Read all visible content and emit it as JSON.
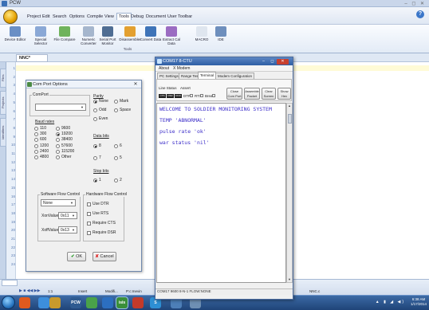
{
  "app": {
    "title": "PCW",
    "window_buttons": "– ◻ ✕",
    "menu": [
      "Project",
      "Edit",
      "Search",
      "Options",
      "Compile",
      "View",
      "Tools",
      "Debug",
      "Document",
      "User Toolbar"
    ],
    "active_menu": "Tools",
    "help": "?"
  },
  "ribbon": {
    "buttons": [
      {
        "label": "Device Editor",
        "color": "#6a8fc5"
      },
      {
        "label": "Special Selector",
        "color": "#8aa8d6"
      },
      {
        "label": "File Compare",
        "color": "#6fb35c"
      },
      {
        "label": "Numeric Converter",
        "color": "#a5b6cd"
      },
      {
        "label": "Serial Port Monitor",
        "color": "#4f6d93"
      },
      {
        "label": "Disassembler",
        "color": "#e3a030"
      },
      {
        "label": "Convert Data",
        "color": "#3f74b8"
      },
      {
        "label": "Extract Cal Data",
        "color": "#9b6cc2"
      },
      {
        "label": "MACRO",
        "color": "#dfe6ef"
      },
      {
        "label": "IDE",
        "color": "#6e8fbd"
      }
    ],
    "group": "Tools"
  },
  "editor": {
    "tab": "NNC*",
    "rail_tabs": [
      "Files",
      "Projects",
      "Identifiers"
    ],
    "line_numbers": [
      "1",
      "2",
      "3",
      "4",
      "5",
      "6",
      "7",
      "8",
      "9",
      "10",
      "11",
      "12",
      "13",
      "14",
      "15",
      "16",
      "17",
      "18",
      "19",
      "20",
      "21",
      "22",
      "23",
      "24"
    ]
  },
  "status": {
    "mini": "",
    "position": "1:1",
    "mode": "Insert",
    "modified": "Modifi...",
    "file": "P:c:mevin",
    "right": "NNC.c"
  },
  "dialog": {
    "title": "Com Port Options",
    "close": "✕",
    "comport_label": "ComPort",
    "comport_value": "",
    "baud_label": "Baud rates",
    "baud_options": [
      "110",
      "300",
      "600",
      "1200",
      "2400",
      "4800",
      "9600",
      "19200",
      "38400",
      "57600",
      "115200",
      "Other"
    ],
    "baud_selected": "19200",
    "parity_label": "Parity",
    "parity_options": [
      "None",
      "Odd",
      "Even",
      "Mark",
      "Space"
    ],
    "parity_selected": "None",
    "databits_label": "Data bits",
    "databits_options": [
      "8",
      "7",
      "6",
      "5"
    ],
    "databits_selected": "8",
    "stopbits_label": "Stop bits",
    "stopbits_options": [
      "1",
      "2"
    ],
    "stopbits_selected": "1",
    "sw_flow_label": "Software Flow Control",
    "sw_flow_value": "None",
    "xon_label": "XonValue",
    "xon_value": "0x11",
    "xoff_label": "XoffValue",
    "xoff_value": "0x13",
    "hw_flow_label": "Hardware Flow Control",
    "hw_options": [
      "Use DTR",
      "Use RTS",
      "Require CTS",
      "Require DSR"
    ],
    "ok": "OK",
    "cancel": "Cancel"
  },
  "terminal": {
    "title": "COM17 8-CTU",
    "menu": [
      "About",
      "X Modem"
    ],
    "tabs": [
      "PC Settings",
      "Range Test",
      "Terminal",
      "Modem Configuration"
    ],
    "active_tab": "Terminal",
    "line_status_label": "Line Status",
    "assert_label": "Assert",
    "leds": [
      "CTS",
      "DSR",
      "DCD"
    ],
    "assert_items": [
      "DTR",
      "RTS",
      "Break"
    ],
    "buttons": [
      "Close Com Port",
      "Assemble Packet",
      "Clear Screen",
      "Show Hex"
    ],
    "lines": [
      "WELCOME TO SOLDIER MONITORING SYSTEM",
      "TEMP 'ABNORMAL'",
      "pulse rate 'ok'",
      "war status 'nil'"
    ],
    "status": "COM17  9600 8-N-1  FLOW:NONE"
  },
  "taskbar": {
    "icons": [
      {
        "label": "",
        "color": "#e05a1e"
      },
      {
        "label": "",
        "color": "#3d8fdc"
      },
      {
        "label": "",
        "color": "#c99a2c"
      },
      {
        "label": "PCW",
        "color": "#2f5b91"
      },
      {
        "label": "",
        "color": "#4aa24a"
      },
      {
        "label": "",
        "color": "#2c6fc0"
      },
      {
        "label": "isis",
        "color": "#3a8f3a"
      },
      {
        "label": "",
        "color": "#c43a2a"
      },
      {
        "label": "S",
        "color": "#2d8fd4"
      },
      {
        "label": "",
        "color": "#4d7fb8"
      },
      {
        "label": "",
        "color": "#6e8fb3"
      }
    ],
    "tray": "▲ ▮ ◢ ◀)",
    "time": "6:38 AM",
    "date": "1/17/2014"
  }
}
